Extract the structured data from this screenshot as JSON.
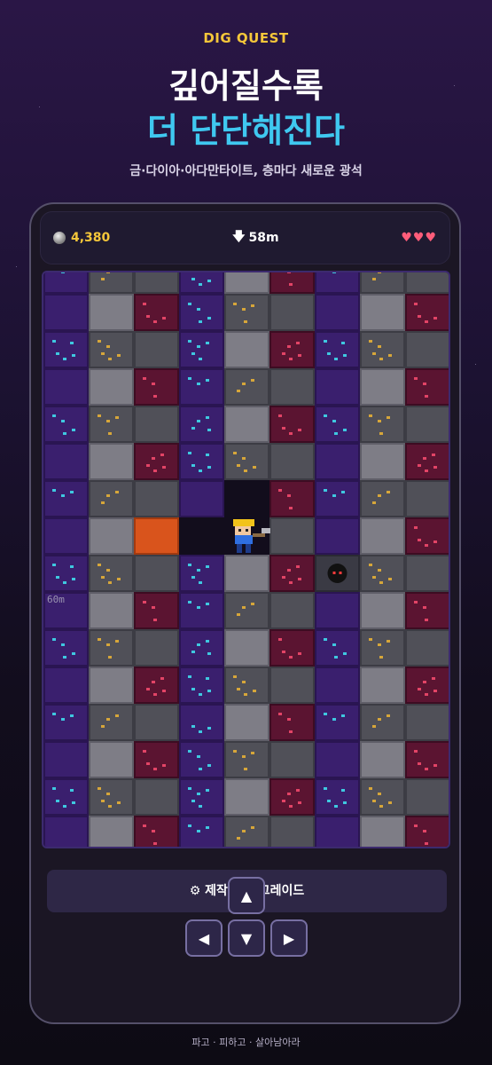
{
  "header": {
    "brand": "DIG QUEST",
    "headline_line1": "깊어질수록",
    "headline_line2": "더 단단해진다",
    "subtitle": "금·다이아·아다만타이트, 층마다 새로운 광석"
  },
  "hud": {
    "coins": "4,380",
    "depth": "58m",
    "hearts": "♥♥♥"
  },
  "board": {
    "depth_marker": "60m",
    "columns": 9,
    "rows": 16
  },
  "controls": {
    "craft_label": "제작 & 업그레이드",
    "up_label": "▲",
    "left_label": "◀",
    "down_label": "▼",
    "right_label": "▶"
  },
  "footer": {
    "tagline": "파고 · 피하고 · 살아남아라"
  },
  "colors": {
    "gold_text": "#f5c73a",
    "cyan_text": "#3fc8f0",
    "heart": "#ff5d7a",
    "purple_block": "#3a1f6e",
    "stone_light": "#7e7d86",
    "stone_dark": "#505058",
    "ruby_block": "#5b1431",
    "lava": "#d9541c"
  }
}
